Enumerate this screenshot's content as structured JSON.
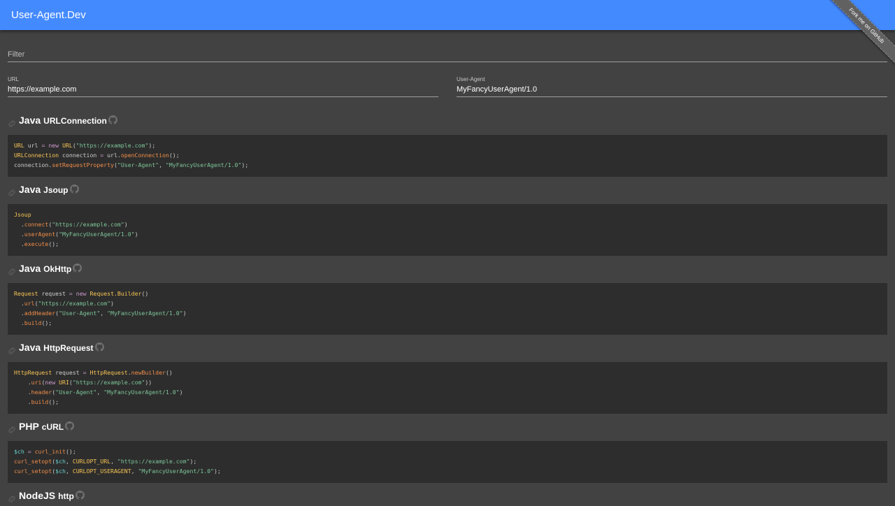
{
  "app": {
    "title": "User-Agent.Dev",
    "ribbon": "Fork me on GitHub"
  },
  "filter": {
    "placeholder": "Filter",
    "value": ""
  },
  "inputs": {
    "url_label": "URL",
    "url_value": "https://example.com",
    "ua_label": "User-Agent",
    "ua_value": "MyFancyUserAgent/1.0"
  },
  "sections": [
    {
      "lang": "Java",
      "lib": "URLConnection",
      "code": [
        [
          [
            "t",
            "URL"
          ],
          [
            "p",
            " url "
          ],
          [
            "k",
            "="
          ],
          [
            "p",
            " "
          ],
          [
            "k",
            "new"
          ],
          [
            "p",
            " "
          ],
          [
            "t",
            "URL"
          ],
          [
            "p",
            "("
          ],
          [
            "s",
            "\"https://example.com\""
          ],
          [
            "p",
            ");"
          ]
        ],
        [
          [
            "t",
            "URLConnection"
          ],
          [
            "p",
            " connection "
          ],
          [
            "k",
            "="
          ],
          [
            "p",
            " url."
          ],
          [
            "f",
            "openConnection"
          ],
          [
            "p",
            "();"
          ]
        ],
        [
          [
            "p",
            "connection."
          ],
          [
            "f",
            "setRequestProperty"
          ],
          [
            "p",
            "("
          ],
          [
            "s",
            "\"User-Agent\""
          ],
          [
            "p",
            ", "
          ],
          [
            "s",
            "\"MyFancyUserAgent/1.0\""
          ],
          [
            "p",
            ");"
          ]
        ]
      ]
    },
    {
      "lang": "Java",
      "lib": "Jsoup",
      "code": [
        [
          [
            "t",
            "Jsoup"
          ]
        ],
        [
          [
            "p",
            "  ."
          ],
          [
            "f",
            "connect"
          ],
          [
            "p",
            "("
          ],
          [
            "s",
            "\"https://example.com\""
          ],
          [
            "p",
            ")"
          ]
        ],
        [
          [
            "p",
            "  ."
          ],
          [
            "f",
            "userAgent"
          ],
          [
            "p",
            "("
          ],
          [
            "s",
            "\"MyFancyUserAgent/1.0\""
          ],
          [
            "p",
            ")"
          ]
        ],
        [
          [
            "p",
            "  ."
          ],
          [
            "f",
            "execute"
          ],
          [
            "p",
            "();"
          ]
        ]
      ]
    },
    {
      "lang": "Java",
      "lib": "OkHttp",
      "code": [
        [
          [
            "t",
            "Request"
          ],
          [
            "p",
            " request "
          ],
          [
            "k",
            "="
          ],
          [
            "p",
            " "
          ],
          [
            "k",
            "new"
          ],
          [
            "p",
            " "
          ],
          [
            "t",
            "Request.Builder"
          ],
          [
            "p",
            "()"
          ]
        ],
        [
          [
            "p",
            "  ."
          ],
          [
            "f",
            "url"
          ],
          [
            "p",
            "("
          ],
          [
            "s",
            "\"https://example.com\""
          ],
          [
            "p",
            ")"
          ]
        ],
        [
          [
            "p",
            "  ."
          ],
          [
            "f",
            "addHeader"
          ],
          [
            "p",
            "("
          ],
          [
            "s",
            "\"User-Agent\""
          ],
          [
            "p",
            ", "
          ],
          [
            "s",
            "\"MyFancyUserAgent/1.0\""
          ],
          [
            "p",
            ")"
          ]
        ],
        [
          [
            "p",
            "  ."
          ],
          [
            "f",
            "build"
          ],
          [
            "p",
            "();"
          ]
        ]
      ]
    },
    {
      "lang": "Java",
      "lib": "HttpRequest",
      "code": [
        [
          [
            "t",
            "HttpRequest"
          ],
          [
            "p",
            " request "
          ],
          [
            "k",
            "="
          ],
          [
            "p",
            " "
          ],
          [
            "t",
            "HttpRequest"
          ],
          [
            "p",
            "."
          ],
          [
            "f",
            "newBuilder"
          ],
          [
            "p",
            "()"
          ]
        ],
        [
          [
            "p",
            "    ."
          ],
          [
            "f",
            "uri"
          ],
          [
            "p",
            "("
          ],
          [
            "k",
            "new"
          ],
          [
            "p",
            " "
          ],
          [
            "t",
            "URI"
          ],
          [
            "p",
            "("
          ],
          [
            "s",
            "\"https://example.com\""
          ],
          [
            "p",
            "))"
          ]
        ],
        [
          [
            "p",
            "    ."
          ],
          [
            "f",
            "header"
          ],
          [
            "p",
            "("
          ],
          [
            "s",
            "\"User-Agent\""
          ],
          [
            "p",
            ", "
          ],
          [
            "s",
            "\"MyFancyUserAgent/1.0\""
          ],
          [
            "p",
            ")"
          ]
        ],
        [
          [
            "p",
            "    ."
          ],
          [
            "f",
            "build"
          ],
          [
            "p",
            "();"
          ]
        ]
      ]
    },
    {
      "lang": "PHP",
      "lib": "cURL",
      "code": [
        [
          [
            "v",
            "$ch"
          ],
          [
            "p",
            " "
          ],
          [
            "k",
            "="
          ],
          [
            "p",
            " "
          ],
          [
            "f",
            "curl_init"
          ],
          [
            "p",
            "();"
          ]
        ],
        [
          [
            "f",
            "curl_setopt"
          ],
          [
            "p",
            "("
          ],
          [
            "v",
            "$ch"
          ],
          [
            "p",
            ", "
          ],
          [
            "t",
            "CURLOPT_URL"
          ],
          [
            "p",
            ", "
          ],
          [
            "s",
            "\"https://example.com\""
          ],
          [
            "p",
            ");"
          ]
        ],
        [
          [
            "f",
            "curl_setopt"
          ],
          [
            "p",
            "("
          ],
          [
            "v",
            "$ch"
          ],
          [
            "p",
            ", "
          ],
          [
            "t",
            "CURLOPT_USERAGENT"
          ],
          [
            "p",
            ", "
          ],
          [
            "s",
            "\"MyFancyUserAgent/1.0\""
          ],
          [
            "p",
            ");"
          ]
        ]
      ]
    },
    {
      "lang": "NodeJS",
      "lib": "http",
      "code": []
    }
  ],
  "colors": {
    "appbar": "#448aff",
    "background": "#424242",
    "code_background": "#2d2d2d",
    "keyword": "#cc99cd",
    "type": "#f8c555",
    "function": "#f08d49",
    "string": "#7ec699",
    "variable": "#67cdcc"
  },
  "icons": {
    "anchor": "link-icon",
    "repo": "github-icon"
  }
}
